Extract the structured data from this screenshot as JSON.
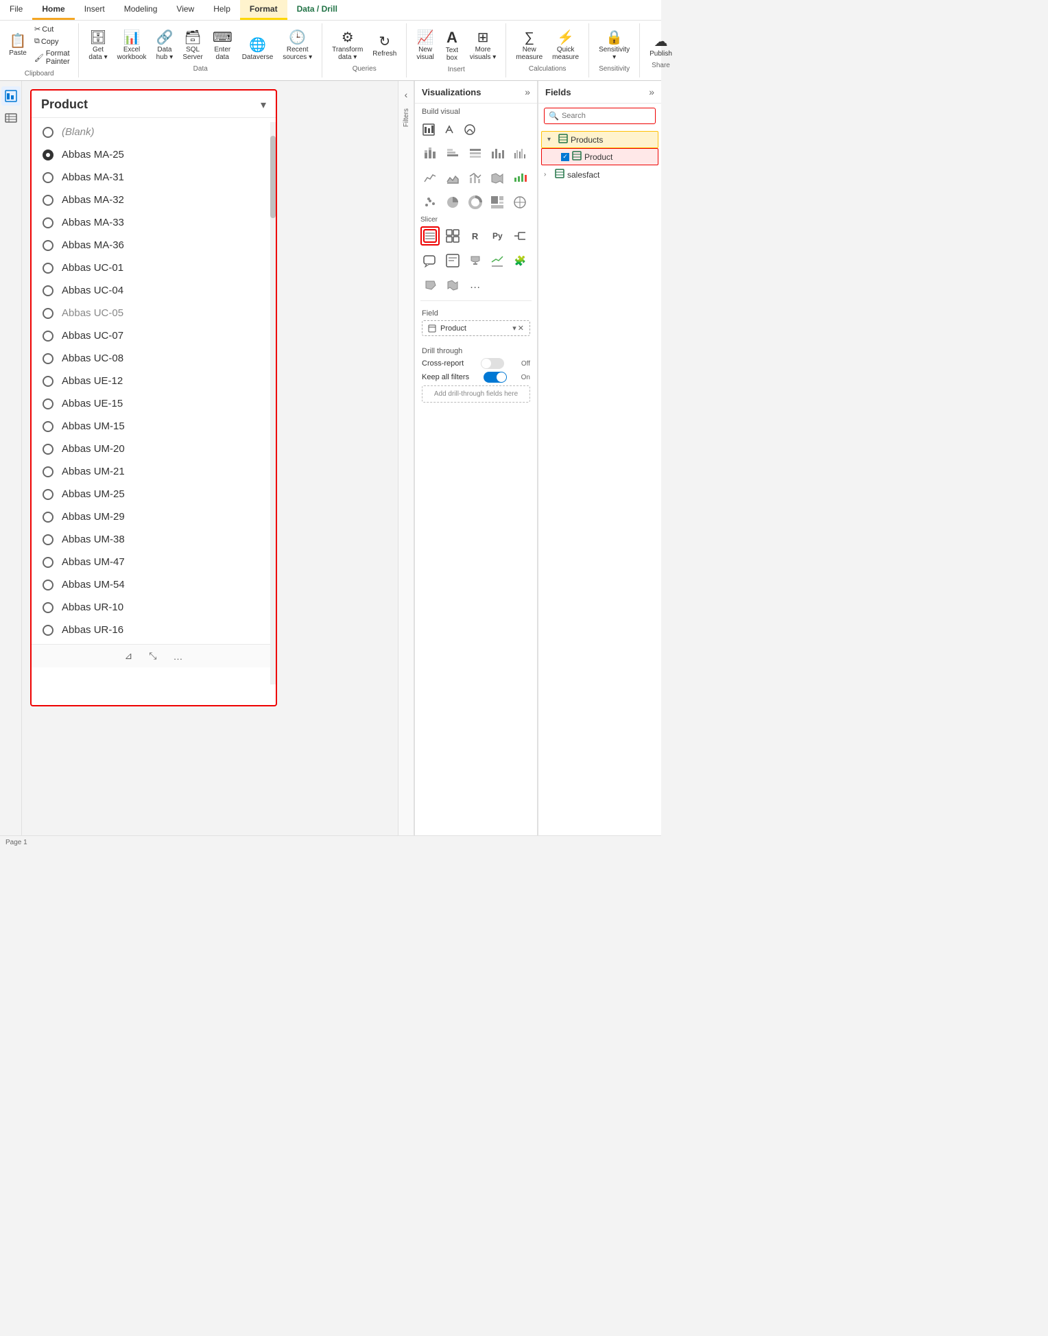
{
  "ribbon": {
    "tabs": [
      "File",
      "Home",
      "Insert",
      "Modeling",
      "View",
      "Help",
      "Format",
      "Data / Drill"
    ],
    "active_tab": "Home",
    "format_tab": "Format",
    "data_tab": "Data / Drill",
    "groups": {
      "clipboard": {
        "label": "Clipboard",
        "buttons": [
          "Paste",
          "Cut",
          "Copy",
          "Format Painter"
        ]
      },
      "data": {
        "label": "Data",
        "buttons": [
          "Get data",
          "Excel workbook",
          "Data hub",
          "SQL Server",
          "Enter data",
          "Dataverse",
          "Recent sources"
        ]
      },
      "queries": {
        "label": "Queries",
        "buttons": [
          "Transform data",
          "Refresh"
        ]
      },
      "insert": {
        "label": "Insert",
        "buttons": [
          "New visual",
          "Text box",
          "More visuals"
        ]
      },
      "calculations": {
        "label": "Calculations",
        "buttons": [
          "New measure",
          "Quick measure"
        ]
      },
      "sensitivity": {
        "label": "Sensitivity",
        "buttons": [
          "Sensitivity"
        ]
      },
      "share": {
        "label": "Share",
        "buttons": [
          "Publish"
        ]
      }
    }
  },
  "slicer": {
    "title": "Product",
    "items": [
      {
        "id": 0,
        "label": "(Blank)",
        "selected": false,
        "blank": true
      },
      {
        "id": 1,
        "label": "Abbas MA-25",
        "selected": true
      },
      {
        "id": 2,
        "label": "Abbas MA-31",
        "selected": false
      },
      {
        "id": 3,
        "label": "Abbas MA-32",
        "selected": false
      },
      {
        "id": 4,
        "label": "Abbas MA-33",
        "selected": false
      },
      {
        "id": 5,
        "label": "Abbas MA-36",
        "selected": false
      },
      {
        "id": 6,
        "label": "Abbas UC-01",
        "selected": false
      },
      {
        "id": 7,
        "label": "Abbas UC-04",
        "selected": false
      },
      {
        "id": 8,
        "label": "Abbas UC-05",
        "selected": false,
        "cursor": true
      },
      {
        "id": 9,
        "label": "Abbas UC-07",
        "selected": false
      },
      {
        "id": 10,
        "label": "Abbas UC-08",
        "selected": false
      },
      {
        "id": 11,
        "label": "Abbas UE-12",
        "selected": false
      },
      {
        "id": 12,
        "label": "Abbas UE-15",
        "selected": false
      },
      {
        "id": 13,
        "label": "Abbas UM-15",
        "selected": false
      },
      {
        "id": 14,
        "label": "Abbas UM-20",
        "selected": false
      },
      {
        "id": 15,
        "label": "Abbas UM-21",
        "selected": false
      },
      {
        "id": 16,
        "label": "Abbas UM-25",
        "selected": false
      },
      {
        "id": 17,
        "label": "Abbas UM-29",
        "selected": false
      },
      {
        "id": 18,
        "label": "Abbas UM-38",
        "selected": false
      },
      {
        "id": 19,
        "label": "Abbas UM-47",
        "selected": false
      },
      {
        "id": 20,
        "label": "Abbas UM-54",
        "selected": false
      },
      {
        "id": 21,
        "label": "Abbas UR-10",
        "selected": false
      },
      {
        "id": 22,
        "label": "Abbas UR-16",
        "selected": false
      }
    ]
  },
  "visualizations": {
    "title": "Visualizations",
    "build_visual_label": "Build visual",
    "slicer_label": "Slicer",
    "field_label": "Field",
    "field_value": "Product",
    "drill_through_label": "Drill through",
    "cross_report_label": "Cross-report",
    "cross_report_state": "Off",
    "keep_all_filters_label": "Keep all filters",
    "keep_all_filters_state": "On",
    "add_drill_label": "Add drill-through fields here"
  },
  "fields": {
    "title": "Fields",
    "search_placeholder": "Search",
    "tree": [
      {
        "name": "Products",
        "icon": "table",
        "expanded": true,
        "highlighted": true,
        "children": [
          {
            "name": "Product",
            "icon": "field",
            "checked": true,
            "highlighted_red": true
          }
        ]
      },
      {
        "name": "salesfact",
        "icon": "table",
        "expanded": false,
        "children": []
      }
    ]
  },
  "filters": {
    "label": "Filters"
  },
  "icons": {
    "paste": "📋",
    "cut": "✂",
    "copy": "⧉",
    "format_painter": "🖌",
    "get_data": "🗄",
    "excel": "📊",
    "data_hub": "🔗",
    "sql": "🗃",
    "enter_data": "⌨",
    "dataverse": "🌐",
    "recent": "🕒",
    "transform": "⚙",
    "refresh": "↻",
    "new_visual": "📈",
    "text_box": "A",
    "more_visuals": "⊞",
    "new_measure": "∑",
    "quick_measure": "⚡",
    "sensitivity": "🔒",
    "publish": "☁",
    "search": "🔍",
    "chevron_down": "▾",
    "expand_right": "›",
    "collapse_left": "‹",
    "filter": "⊿",
    "resize": "⤡",
    "more": "…"
  },
  "colors": {
    "accent_red": "#e00000",
    "accent_blue": "#0078d4",
    "toggle_on": "#0078d4",
    "toggle_off": "#e0e0e0",
    "header_bg": "#fff",
    "panel_bg": "#fff",
    "canvas_bg": "#f3f3f3",
    "active_tab_border": "#f5a623"
  }
}
